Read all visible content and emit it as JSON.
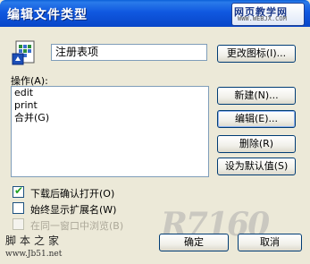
{
  "window": {
    "title": "编辑文件类型",
    "watermark_line1": "网页教学网",
    "watermark_line2": "WWW.WEBJX.COM"
  },
  "file_type": {
    "name_value": "注册表项",
    "change_icon_label": "更改图标(I)..."
  },
  "actions": {
    "label": "操作(A):",
    "items": [
      "edit",
      "print",
      "合并(G)"
    ],
    "new_label": "新建(N)...",
    "edit_label": "编辑(E)...",
    "delete_label": "删除(R)",
    "set_default_label": "设为默认值(S)"
  },
  "options": {
    "confirm_open": {
      "label": "下载后确认打开(O)",
      "checked": true
    },
    "always_show_ext": {
      "label": "始终显示扩展名(W)",
      "checked": false
    },
    "browse_same_window": {
      "label": "在同一窗口中浏览(B)",
      "checked": false,
      "disabled": true
    }
  },
  "footer": {
    "ok_label": "确定",
    "cancel_label": "取消",
    "site_name": "脚本之家",
    "site_url": "www.Jb51.net",
    "logo_text": "R7160"
  },
  "colors": {
    "titlebar": "#0a5fd8",
    "dialog_bg": "#ece9d8",
    "check_mark": "#21a121"
  }
}
